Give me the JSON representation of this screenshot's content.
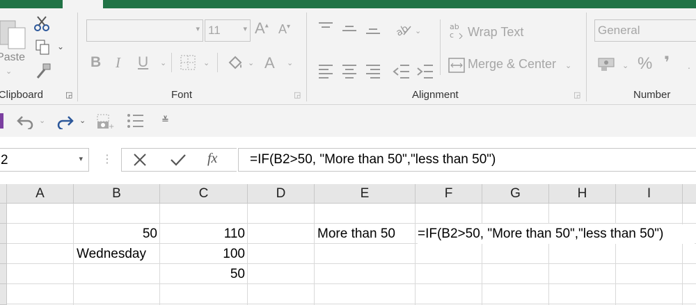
{
  "ribbon": {
    "clipboard": {
      "paste_label": "Paste",
      "group_label": "Clipboard"
    },
    "font": {
      "font_name": "",
      "font_size": "11",
      "grow_label": "A",
      "shrink_label": "A",
      "bold": "B",
      "italic": "I",
      "underline": "U",
      "font_color_label": "A",
      "group_label": "Font"
    },
    "alignment": {
      "wrap_text": "Wrap Text",
      "merge_center": "Merge & Center",
      "group_label": "Alignment"
    },
    "number": {
      "format": "General",
      "percent": "%",
      "comma": "❜",
      "group_label": "Number"
    }
  },
  "formula_bar": {
    "name_box": "2",
    "fx": "fx",
    "formula": "=IF(B2>50, \"More than 50\",\"less than 50\")"
  },
  "sheet": {
    "columns": [
      "A",
      "B",
      "C",
      "D",
      "E",
      "F",
      "G",
      "H",
      "I"
    ],
    "cells": {
      "B2": "50",
      "C2": "110",
      "E2": "More than 50",
      "F2": "=IF(B2>50, \"More than 50\",\"less than 50\")",
      "B3": "Wednesday",
      "C3": "100",
      "C4": "50"
    }
  },
  "colors": {
    "accent": "#217346",
    "ribbon_bg": "#f3f3f3",
    "header_bg": "#e6e6e6",
    "icon_blue": "#2b579a"
  }
}
